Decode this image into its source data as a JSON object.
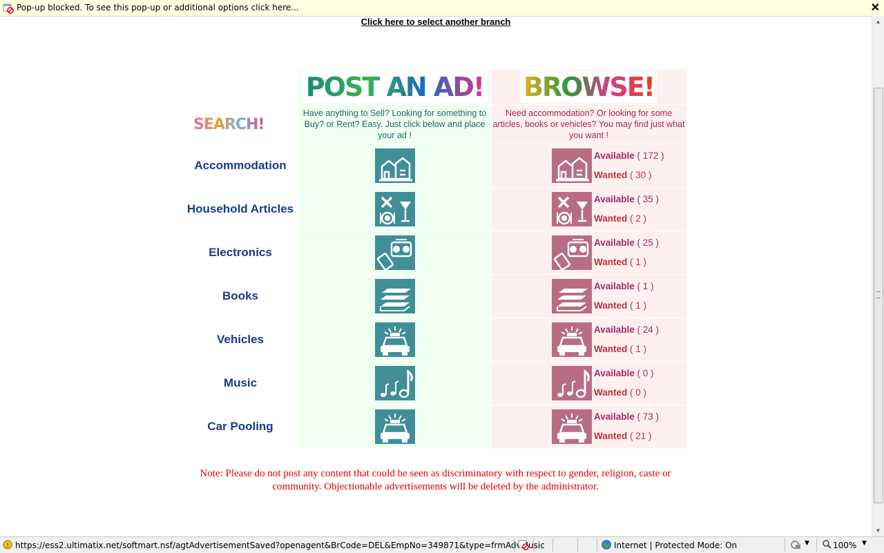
{
  "infobar": {
    "text": "Pop-up blocked. To see this pop-up or additional options click here...",
    "close": "✕"
  },
  "branch_link": "Click here to select another branch",
  "logos": {
    "post": "POST AN AD!",
    "browse": "BROWSE!",
    "search": "SEARCH!"
  },
  "descriptions": {
    "post": "Have anything to Sell? Looking for something to Buy? or Rent? Easy. Just click below and place your ad !",
    "browse": "Need accommodation? Or looking for some articles, books or vehicles? You may find just what you want !"
  },
  "labels": {
    "available": "Available",
    "wanted": "Wanted"
  },
  "categories": [
    {
      "name": "Accommodation",
      "icon": "house-icon",
      "available": "( 172 )",
      "wanted": "( 30 )"
    },
    {
      "name": "Household Articles",
      "icon": "tools-dining-icon",
      "available": "( 35 )",
      "wanted": "( 2 )"
    },
    {
      "name": "Electronics",
      "icon": "radio-phone-icon",
      "available": "( 25 )",
      "wanted": "( 1 )"
    },
    {
      "name": "Books",
      "icon": "books-icon",
      "available": "( 1 )",
      "wanted": "( 1 )"
    },
    {
      "name": "Vehicles",
      "icon": "car-icon",
      "available": "( 24 )",
      "wanted": "( 1 )"
    },
    {
      "name": "Music",
      "icon": "music-notes-icon",
      "available": "( 0 )",
      "wanted": "( 0 )"
    },
    {
      "name": "Car Pooling",
      "icon": "car-icon",
      "available": "( 73 )",
      "wanted": "( 21 )"
    }
  ],
  "note": "Note: Please do not post any content that could be seen as discriminatory with respect to gender, religion, caste or community. Objectionable advertisements will be deleted by the administrator.",
  "statusbar": {
    "url": "https://ess2.ultimatix.net/softmart.nsf/agtAdvertisementSaved?openagent&BrCode=DEL&EmpNo=349871&type=frmAdvMusic",
    "zone": "Internet | Protected Mode: On",
    "zoom": "100%"
  },
  "colors": {
    "post_bg": "#effff0",
    "browse_bg": "#fff0f0",
    "post_icon": "#3f8e98",
    "browse_icon": "#b86d85",
    "category_text": "#1a3a8a",
    "note_text": "#dd0000"
  }
}
